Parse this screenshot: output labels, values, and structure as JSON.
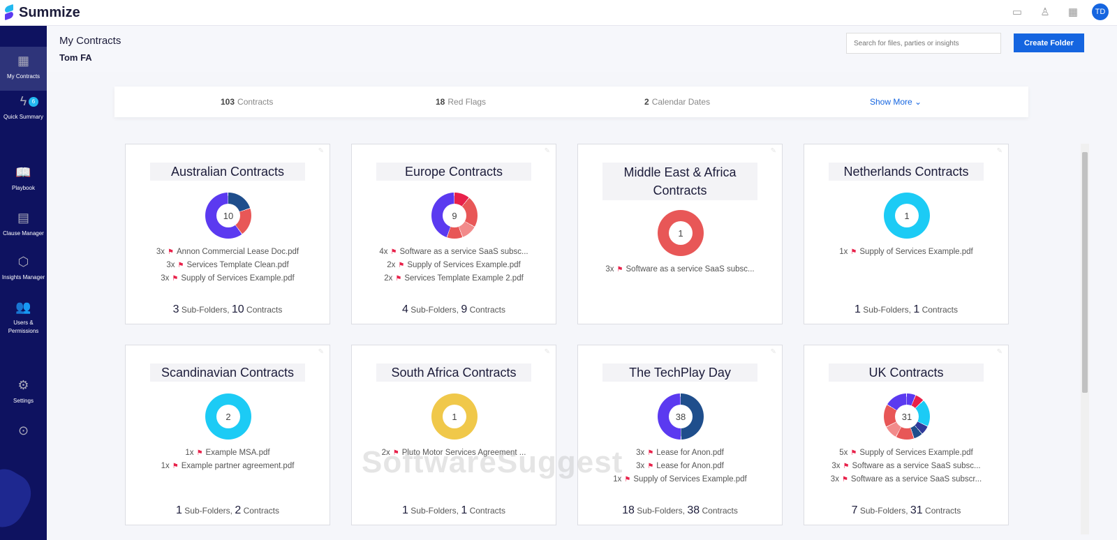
{
  "app": {
    "name": "Summize",
    "avatar": "TD"
  },
  "top_icons": [
    "chat-icon",
    "user-icon",
    "calendar-icon"
  ],
  "sidebar": [
    {
      "label": "My Contracts",
      "icon": "grid-icon",
      "glyph": "▦",
      "active": true
    },
    {
      "label": "Quick Summary",
      "icon": "lightning-icon",
      "glyph": "ϟ",
      "badge": "6"
    },
    {
      "label": "Playbook",
      "icon": "book-icon",
      "glyph": "📖"
    },
    {
      "label": "Clause Manager",
      "icon": "inbox-icon",
      "glyph": "▤"
    },
    {
      "label": "Insights Manager",
      "icon": "cube-icon",
      "glyph": "⬡"
    },
    {
      "label": "Users & Permissions",
      "icon": "users-icon",
      "glyph": "👥"
    },
    {
      "label": "Settings",
      "icon": "gear-icon",
      "glyph": "⚙"
    },
    {
      "label": "",
      "icon": "expand-icon",
      "glyph": "⊙"
    }
  ],
  "header": {
    "title": "My Contracts",
    "subtitle": "Tom FA",
    "search_placeholder": "Search for files, parties or insights",
    "create_label": "Create Folder"
  },
  "stats": [
    {
      "value": "103",
      "label": "Contracts"
    },
    {
      "value": "18",
      "label": "Red Flags"
    },
    {
      "value": "2",
      "label": "Calendar Dates"
    }
  ],
  "show_more": "Show More",
  "watermark": "SoftwareSuggest",
  "cards": [
    {
      "title": "Australian Contracts",
      "total": "10",
      "segments": [
        [
          "#1f4e8c",
          2
        ],
        [
          "#e85757",
          2
        ],
        [
          "#5b3af0",
          6
        ]
      ],
      "flags": [
        [
          "3x",
          "Annon Commercial Lease Doc.pdf"
        ],
        [
          "3x",
          "Services Template Clean.pdf"
        ],
        [
          "3x",
          "Supply of Services Example.pdf"
        ]
      ],
      "sub": "3",
      "contracts": "10"
    },
    {
      "title": "Europe Contracts",
      "total": "9",
      "segments": [
        [
          "#e8214a",
          1
        ],
        [
          "#e85757",
          2
        ],
        [
          "#f28b8b",
          1
        ],
        [
          "#e85757",
          1
        ],
        [
          "#5b3af0",
          4
        ]
      ],
      "flags": [
        [
          "4x",
          "Software as a service SaaS subsc..."
        ],
        [
          "2x",
          "Supply of Services Example.pdf"
        ],
        [
          "2x",
          "Services Template Example 2.pdf"
        ]
      ],
      "sub": "4",
      "contracts": "9"
    },
    {
      "title": "Middle East & Africa Contracts",
      "total": "1",
      "segments": [
        [
          "#e85757",
          1
        ]
      ],
      "flags": [
        [
          "3x",
          "Software as a service SaaS subsc..."
        ]
      ],
      "sub": "",
      "contracts": ""
    },
    {
      "title": "Netherlands Contracts",
      "total": "1",
      "segments": [
        [
          "#1ccbf5",
          1
        ]
      ],
      "flags": [
        [
          "1x",
          "Supply of Services Example.pdf"
        ]
      ],
      "sub": "1",
      "contracts": "1"
    },
    {
      "title": "Scandinavian Contracts",
      "total": "2",
      "segments": [
        [
          "#1ccbf5",
          2
        ]
      ],
      "flags": [
        [
          "1x",
          "Example MSA.pdf"
        ],
        [
          "1x",
          "Example partner agreement.pdf"
        ]
      ],
      "sub": "1",
      "contracts": "2"
    },
    {
      "title": "South Africa Contracts",
      "total": "1",
      "segments": [
        [
          "#f0c84a",
          1
        ]
      ],
      "flags": [
        [
          "2x",
          "Pluto Motor Services Agreement ..."
        ]
      ],
      "sub": "1",
      "contracts": "1"
    },
    {
      "title": "The TechPlay Day",
      "total": "38",
      "segments": [
        [
          "#1f4e8c",
          19
        ],
        [
          "#5b3af0",
          19
        ]
      ],
      "flags": [
        [
          "3x",
          "Lease for Anon.pdf"
        ],
        [
          "3x",
          "Lease for Anon.pdf"
        ],
        [
          "1x",
          "Supply of Services Example.pdf"
        ]
      ],
      "sub": "18",
      "contracts": "38"
    },
    {
      "title": "UK Contracts",
      "total": "31",
      "segments": [
        [
          "#5b3af0",
          2
        ],
        [
          "#e8214a",
          2
        ],
        [
          "#1ccbf5",
          6
        ],
        [
          "#2f3a9a",
          2
        ],
        [
          "#1f4e8c",
          2
        ],
        [
          "#e85757",
          4
        ],
        [
          "#f28b8b",
          3
        ],
        [
          "#e85757",
          5
        ],
        [
          "#5b3af0",
          5
        ]
      ],
      "flags": [
        [
          "5x",
          "Supply of Services Example.pdf"
        ],
        [
          "3x",
          "Software as a service SaaS subsc..."
        ],
        [
          "3x",
          "Software as a service SaaS subscr..."
        ]
      ],
      "sub": "7",
      "contracts": "31"
    }
  ],
  "labels": {
    "subfolders": "Sub-Folders,",
    "contracts": "Contracts"
  }
}
